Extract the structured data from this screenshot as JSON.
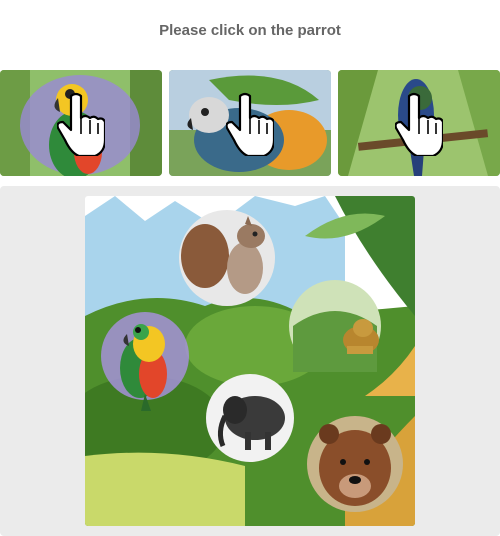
{
  "captcha": {
    "instruction": "Please click on the parrot"
  },
  "examples": [
    {
      "animal": "parrot",
      "icon": "hand-pointer-icon"
    },
    {
      "animal": "parrot",
      "icon": "hand-pointer-icon"
    },
    {
      "animal": "parrot",
      "icon": "hand-pointer-icon"
    }
  ],
  "scene": {
    "animals": [
      "squirrel",
      "parrot",
      "lion",
      "elephant",
      "bear"
    ],
    "colors": {
      "sky": "#a9d4ec",
      "jungle": "#4f8f2c",
      "panel": "#ebebeb",
      "title": "#666666"
    }
  }
}
